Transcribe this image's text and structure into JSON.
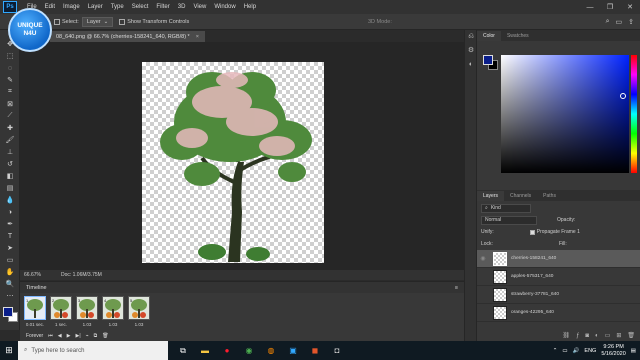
{
  "watermark": {
    "line1": "UNIQUE",
    "line2": "N4U"
  },
  "menubar": {
    "logo": "Ps",
    "items": [
      "File",
      "Edit",
      "Image",
      "Layer",
      "Type",
      "Select",
      "Filter",
      "3D",
      "View",
      "Window",
      "Help"
    ]
  },
  "window_controls": {
    "minimize": "—",
    "maximize": "❐",
    "close": "✕"
  },
  "options_bar": {
    "select_label": "Select:",
    "select_value": "Layer",
    "show_transform_label": "Show Transform Controls",
    "mode_3d": "3D Mode:"
  },
  "document": {
    "tab_title": "08_640.png @ 66.7% (cherries-158241_640, RGB/8) *",
    "close": "×",
    "zoom": "66.67%",
    "doc_info": "Doc: 1.06M/3.75M"
  },
  "timeline": {
    "title": "Timeline",
    "frames": [
      {
        "num": "1",
        "duration": "0.01 sec.",
        "selected": true
      },
      {
        "num": "2",
        "duration": "1 sec.",
        "selected": false
      },
      {
        "num": "3",
        "duration": "1.03",
        "selected": false
      },
      {
        "num": "4",
        "duration": "1.03",
        "selected": false
      },
      {
        "num": "5",
        "duration": "1.03",
        "selected": false
      }
    ],
    "loop": "Forever"
  },
  "color_panel": {
    "tabs": [
      "Color",
      "Swatches"
    ],
    "foreground": "#0a1e8a",
    "background": "#000000"
  },
  "layers_panel": {
    "tabs": [
      "Layers",
      "Channels",
      "Paths"
    ],
    "filter_kind": "Kind",
    "blend_mode": "Normal",
    "opacity_label": "Opacity:",
    "unify_label": "Unify:",
    "propagate_label": "Propagate Frame 1",
    "lock_label": "Lock:",
    "fill_label": "Fill:",
    "layers": [
      {
        "name": "cherries-158241_640",
        "selected": true
      },
      {
        "name": "apples-575317_640",
        "selected": false
      },
      {
        "name": "strawberry-37781_640",
        "selected": false
      },
      {
        "name": "oranges-42295_640",
        "selected": false
      }
    ]
  },
  "taskbar": {
    "search_placeholder": "Type here to search",
    "lang": "ENG",
    "time": "9:26 PM",
    "date": "5/16/2020"
  }
}
